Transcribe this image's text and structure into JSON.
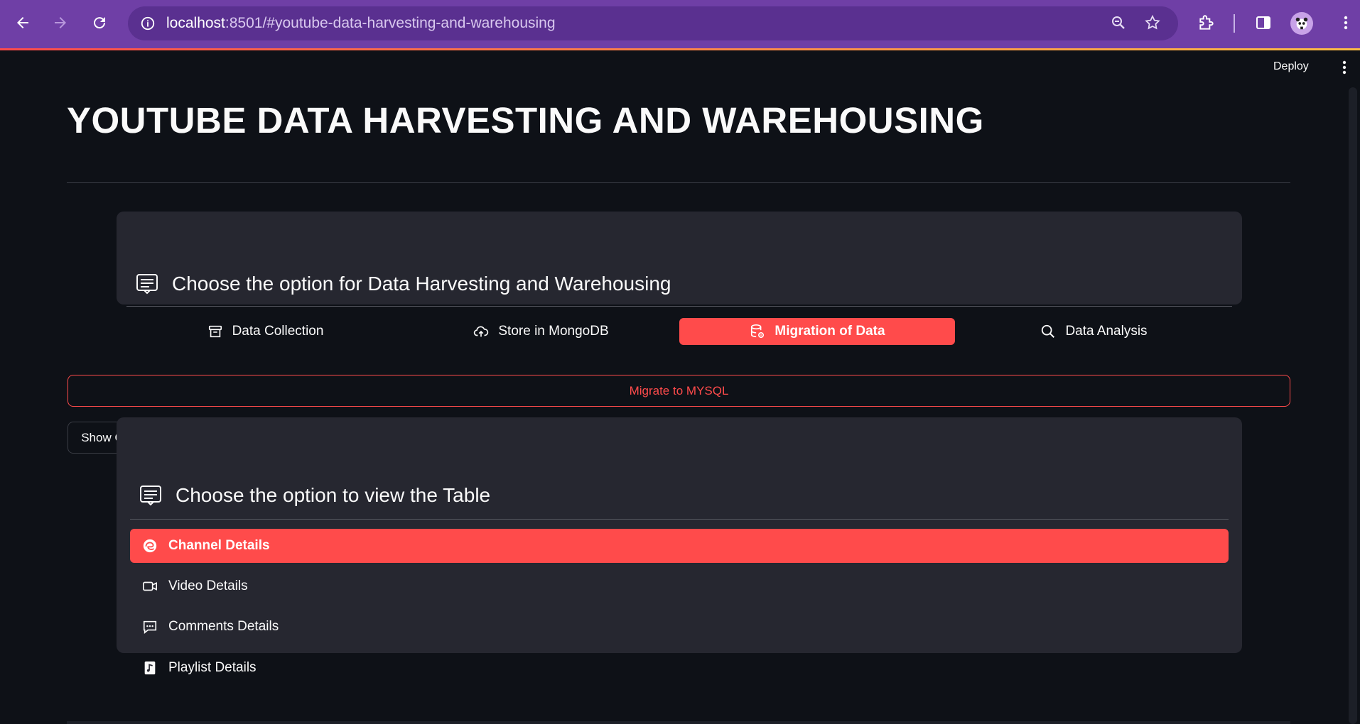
{
  "browser": {
    "url_host": "localhost",
    "url_rest": ":8501/#youtube-data-harvesting-and-warehousing"
  },
  "header": {
    "deploy_label": "Deploy"
  },
  "page": {
    "title": "YOUTUBE DATA HARVESTING AND WAREHOUSING"
  },
  "option_menu": {
    "heading": "Choose the option for Data Harvesting and Warehousing",
    "items": [
      {
        "label": "Data Collection",
        "icon": "archive-icon",
        "active": false
      },
      {
        "label": "Store in MongoDB",
        "icon": "cloud-upload-icon",
        "active": false
      },
      {
        "label": "Migration of Data",
        "icon": "database-gear-icon",
        "active": true
      },
      {
        "label": "Data Analysis",
        "icon": "search-icon",
        "active": false
      }
    ]
  },
  "actions": {
    "migrate_label": "Migrate to MYSQL",
    "show_menu_label": "Show Option Menu"
  },
  "table_menu": {
    "heading": "Choose the option to view the Table",
    "items": [
      {
        "label": "Channel Details",
        "icon": "edge-icon",
        "active": true
      },
      {
        "label": "Video Details",
        "icon": "camera-video-icon",
        "active": false
      },
      {
        "label": "Comments Details",
        "icon": "chat-dots-icon",
        "active": false
      },
      {
        "label": "Playlist Details",
        "icon": "music-file-icon",
        "active": false
      }
    ]
  },
  "colors": {
    "accent": "#ff4b4b",
    "background": "#0e1117",
    "panel": "#262730",
    "chrome": "#6f3fa6"
  }
}
